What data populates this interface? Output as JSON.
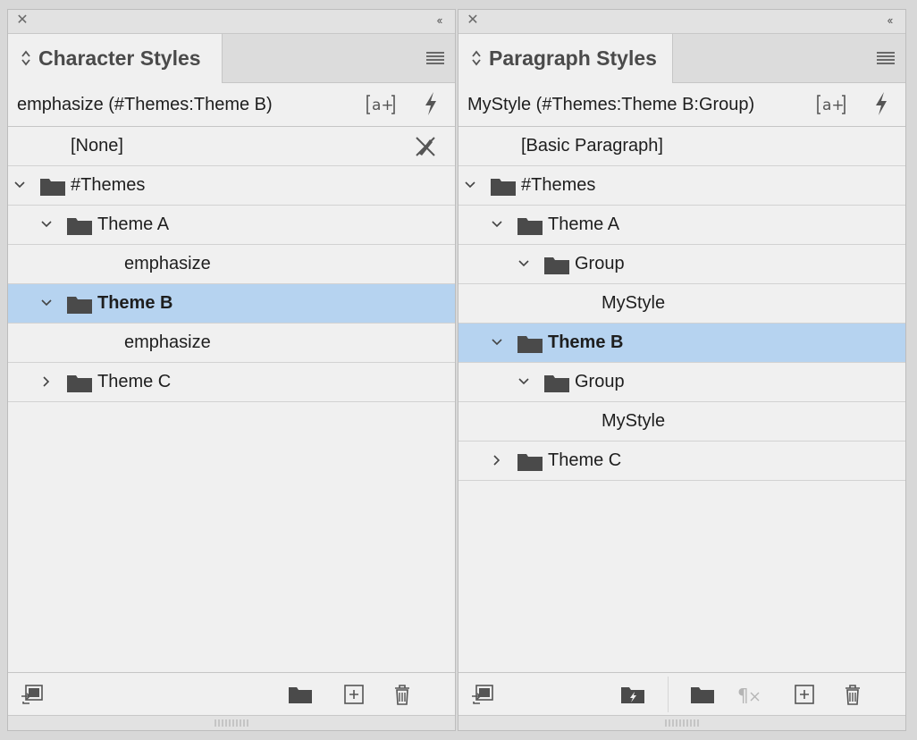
{
  "char_panel": {
    "tab_title": "Character Styles",
    "selected_path": "emphasize (#Themes:Theme B)",
    "rows": [
      {
        "label": "[None]"
      },
      {
        "label": "#Themes"
      },
      {
        "label": "Theme A"
      },
      {
        "label": "emphasize"
      },
      {
        "label": "Theme B"
      },
      {
        "label": "emphasize"
      },
      {
        "label": "Theme C"
      }
    ]
  },
  "para_panel": {
    "tab_title": "Paragraph Styles",
    "selected_path": "MyStyle (#Themes:Theme B:Group)",
    "rows": [
      {
        "label": "[Basic Paragraph]"
      },
      {
        "label": "#Themes"
      },
      {
        "label": "Theme A"
      },
      {
        "label": "Group"
      },
      {
        "label": "MyStyle"
      },
      {
        "label": "Theme B"
      },
      {
        "label": "Group"
      },
      {
        "label": "MyStyle"
      },
      {
        "label": "Theme C"
      }
    ]
  },
  "icons": {
    "close": "close-icon",
    "collapse": "collapse-panel-icon",
    "panel_menu": "panel-menu-icon",
    "new_from_selection": "create-style-from-selection-icon",
    "quick_apply": "quick-apply-lightning-icon",
    "folder": "folder-icon",
    "delete": "trash-icon"
  },
  "colors": {
    "selection": "#b6d3f0",
    "panel_bg": "#f0f0f0",
    "folder": "#4a4a4a"
  }
}
